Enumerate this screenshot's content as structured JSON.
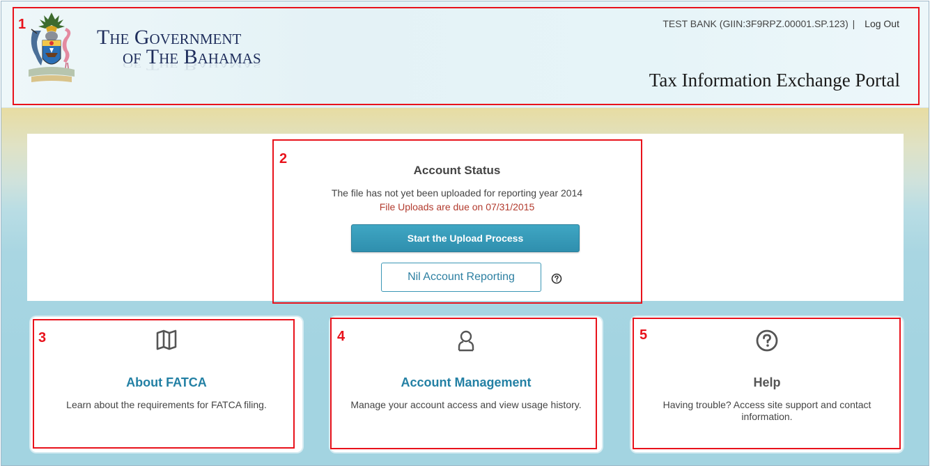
{
  "header": {
    "gov_line1": "The Government",
    "gov_line2": "of The Bahamas",
    "account_label": "TEST BANK (GIIN:3F9RPZ.00001.SP.123)",
    "separator": "|",
    "logout_label": "Log Out",
    "portal_title": "Tax Information Exchange Portal"
  },
  "status": {
    "title": "Account Status",
    "message": "The file has not yet been uploaded for reporting year 2014",
    "due_text": "File Uploads are due on 07/31/2015",
    "upload_button": "Start the Upload Process",
    "nil_button": "Nil Account Reporting",
    "nil_help_icon": "question-circle-icon"
  },
  "cards": [
    {
      "icon": "open-book-icon",
      "title": "About FATCA",
      "description": "Learn about the requirements for FATCA filing."
    },
    {
      "icon": "user-icon",
      "title": "Account Management",
      "description": "Manage your account access and view usage history."
    },
    {
      "icon": "question-circle-icon",
      "title": "Help",
      "description": "Having trouble? Access site support and contact information."
    }
  ],
  "callouts": [
    "1",
    "2",
    "3",
    "4",
    "5"
  ],
  "colors": {
    "callout_red": "#e8121b",
    "link_teal": "#2380a4",
    "upload_button": "#3399b8",
    "due_red": "#b23b2e",
    "header_navy": "#1f2e5c"
  }
}
